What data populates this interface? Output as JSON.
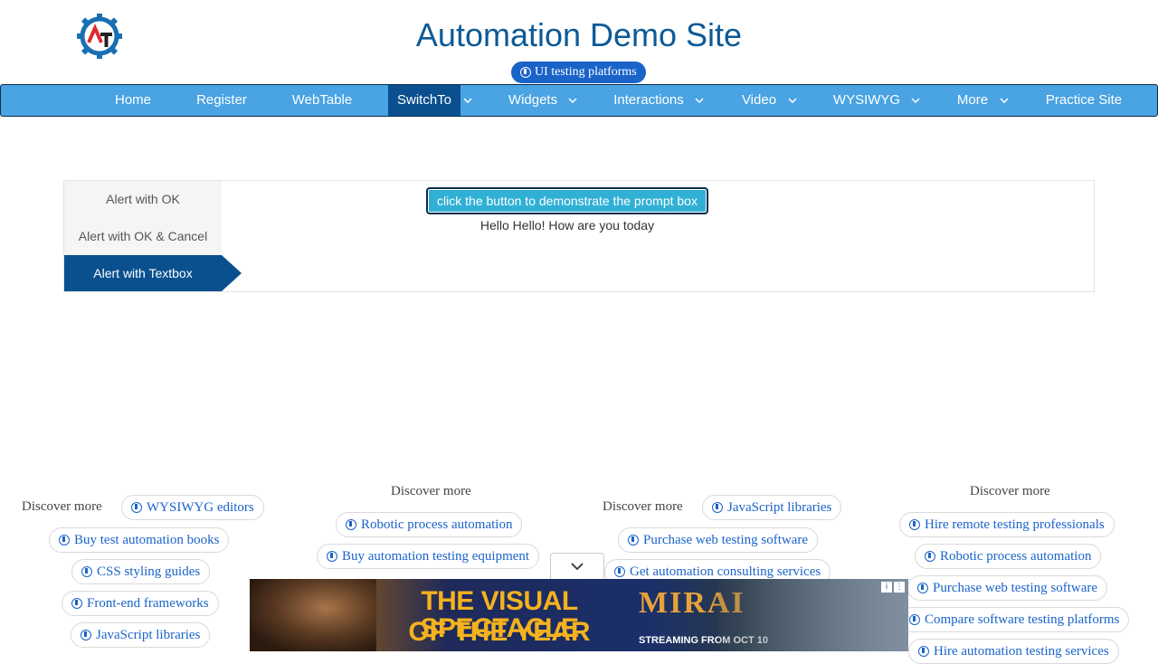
{
  "site": {
    "title": "Automation Demo Site",
    "pill_label": "UI testing platforms"
  },
  "nav": {
    "items": [
      {
        "label": "Home"
      },
      {
        "label": "Register"
      },
      {
        "label": "WebTable"
      },
      {
        "label": "SwitchTo",
        "active": true
      },
      {
        "label": "Widgets"
      },
      {
        "label": "Interactions"
      },
      {
        "label": "Video"
      },
      {
        "label": "WYSIWYG"
      },
      {
        "label": "More"
      },
      {
        "label": "Practice Site"
      }
    ]
  },
  "tabs": [
    "Alert with OK",
    "Alert with OK & Cancel",
    "Alert with Textbox"
  ],
  "active_tab": "Alert with Textbox",
  "prompt_button": "click the button to demonstrate the prompt box",
  "result_text": "Hello Hello! How are you today",
  "discover": {
    "label": "Discover more",
    "col1": [
      "WYSIWYG editors",
      "Buy test automation books",
      "CSS styling guides",
      "Front-end frameworks",
      "JavaScript libraries"
    ],
    "col2": [
      "Robotic process automation",
      "Buy automation testing equipment"
    ],
    "col3": [
      "JavaScript libraries",
      "Purchase web testing software",
      "Get automation consulting services"
    ],
    "col4": [
      "Hire remote testing professionals",
      "Robotic process automation",
      "Purchase web testing software",
      "Compare software testing platforms",
      "Hire automation testing services"
    ]
  },
  "ad": {
    "headline_1": "THE VISUAL SPECTACLE",
    "headline_2": "OF THE YEAR",
    "brand": "MIRAI",
    "date_text": "STREAMING FROM OCT 10"
  }
}
